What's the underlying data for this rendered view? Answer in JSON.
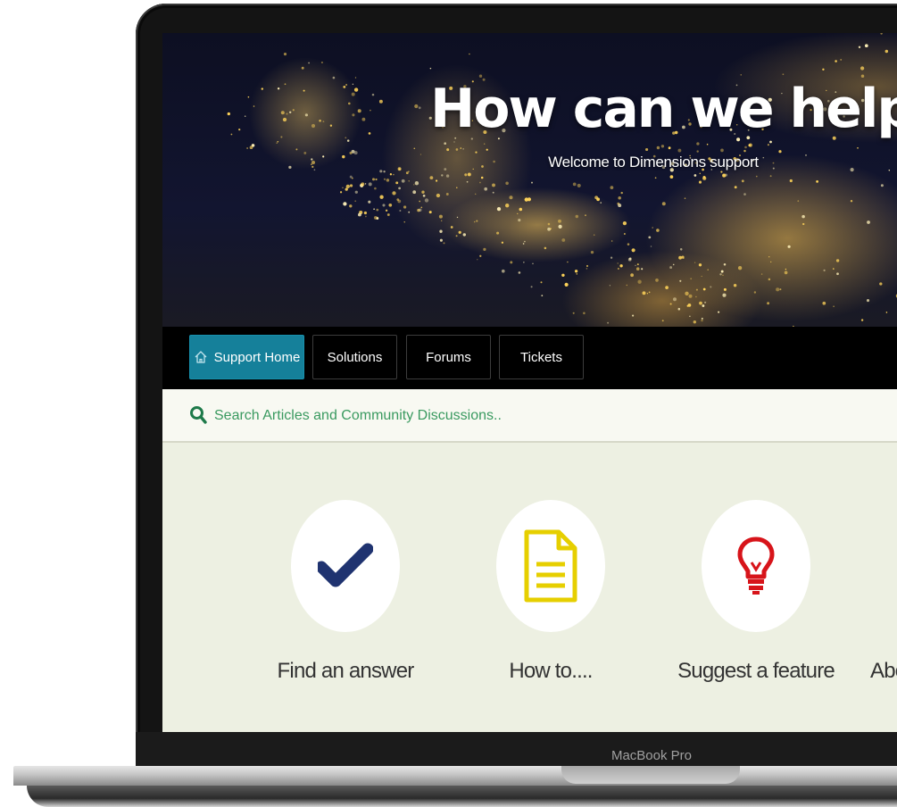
{
  "device": {
    "brand_label": "MacBook Pro"
  },
  "hero": {
    "title": "How can we help?",
    "subtitle": "Welcome to Dimensions support"
  },
  "nav": {
    "items": [
      {
        "label": "Support Home",
        "icon": "home-icon",
        "active": true
      },
      {
        "label": "Solutions",
        "active": false
      },
      {
        "label": "Forums",
        "active": false
      },
      {
        "label": "Tickets",
        "active": false
      }
    ]
  },
  "search": {
    "placeholder": "Search Articles and Community Discussions..",
    "icon": "search-icon",
    "icon_color": "#1e7a4a"
  },
  "cards": [
    {
      "label": "Find an answer",
      "icon": "checkmark-icon",
      "icon_color": "#1f3370"
    },
    {
      "label": "How to....",
      "icon": "document-icon",
      "icon_color": "#e6cf00"
    },
    {
      "label": "Suggest a feature",
      "icon": "lightbulb-icon",
      "icon_color": "#d7141a"
    },
    {
      "label": "Abo",
      "icon": "",
      "icon_color": ""
    }
  ],
  "colors": {
    "nav_active": "#15809a",
    "content_bg": "#edf0e2",
    "search_text": "#2e8b57"
  }
}
